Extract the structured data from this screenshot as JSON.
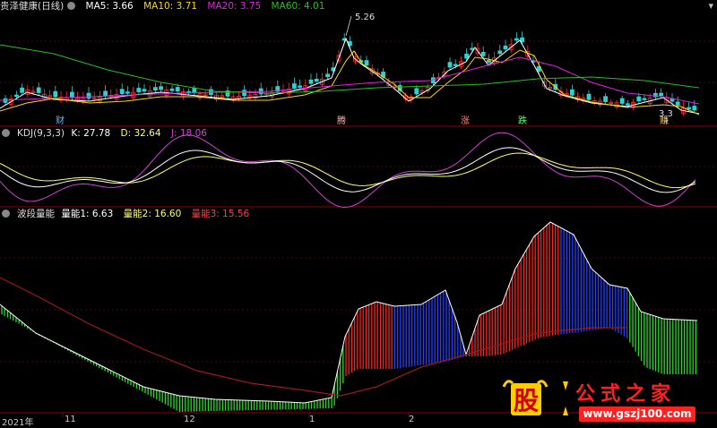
{
  "colors": {
    "bg": "#000000",
    "divider": "#8b0000",
    "grid": "#5a1010",
    "ma5": "#ffffff",
    "ma10": "#ffd700",
    "ma20": "#e020e0",
    "ma60": "#20c020",
    "up": "#ff3030",
    "down": "#30d0d0",
    "k": "#ffffff",
    "d": "#ffff60",
    "j": "#d040d0",
    "wave_red": "#ff2020",
    "wave_blue": "#2040ff",
    "wave_green": "#20e020",
    "line3": "#a01818"
  },
  "main": {
    "title": "贵泽健康(日线)",
    "ma5": {
      "label": "MA5:",
      "value": "3.66"
    },
    "ma10": {
      "label": "MA10:",
      "value": "3.71"
    },
    "ma20": {
      "label": "MA20:",
      "value": "3.75"
    },
    "ma60": {
      "label": "MA60:",
      "value": "4.01"
    },
    "high_label": "5.26",
    "low_label": "3.3",
    "markers": [
      "财",
      "腾",
      "涨",
      "跌",
      "赚"
    ],
    "corner_icon": "menu-icon"
  },
  "kdj": {
    "title": "KDJ(9,3,3)",
    "k": {
      "label": "K:",
      "value": "27.78"
    },
    "d": {
      "label": "D:",
      "value": "32.64"
    },
    "j": {
      "label": "J:",
      "value": "18.06"
    }
  },
  "wave": {
    "title": "波段量能",
    "l1": {
      "label": "量能1:",
      "value": "6.63"
    },
    "l2": {
      "label": "量能2:",
      "value": "16.60"
    },
    "l3": {
      "label": "量能3:",
      "value": "15.56"
    }
  },
  "xaxis": {
    "labels": [
      "2021年",
      "11",
      "12",
      "1",
      "2"
    ]
  },
  "watermark": {
    "char": "股",
    "text": "公式之家",
    "url": "www.gszj100.com"
  },
  "chart_data": [
    {
      "type": "candlestick",
      "panel": "price",
      "title": "贵泽健康(日线)",
      "series": [
        {
          "name": "MA5",
          "last": 3.66
        },
        {
          "name": "MA10",
          "last": 3.71
        },
        {
          "name": "MA20",
          "last": 3.75
        },
        {
          "name": "MA60",
          "last": 4.01
        }
      ],
      "annotations": [
        {
          "text": "5.26",
          "type": "high"
        },
        {
          "text": "3.3",
          "type": "low"
        }
      ]
    },
    {
      "type": "line",
      "panel": "indicator",
      "title": "KDJ(9,3,3)",
      "series": [
        {
          "name": "K",
          "last": 27.78
        },
        {
          "name": "D",
          "last": 32.64
        },
        {
          "name": "J",
          "last": 18.06
        }
      ]
    },
    {
      "type": "bar",
      "panel": "indicator",
      "title": "波段量能",
      "series": [
        {
          "name": "量能1",
          "last": 6.63
        },
        {
          "name": "量能2",
          "last": 16.6
        },
        {
          "name": "量能3",
          "last": 15.56
        }
      ]
    }
  ]
}
